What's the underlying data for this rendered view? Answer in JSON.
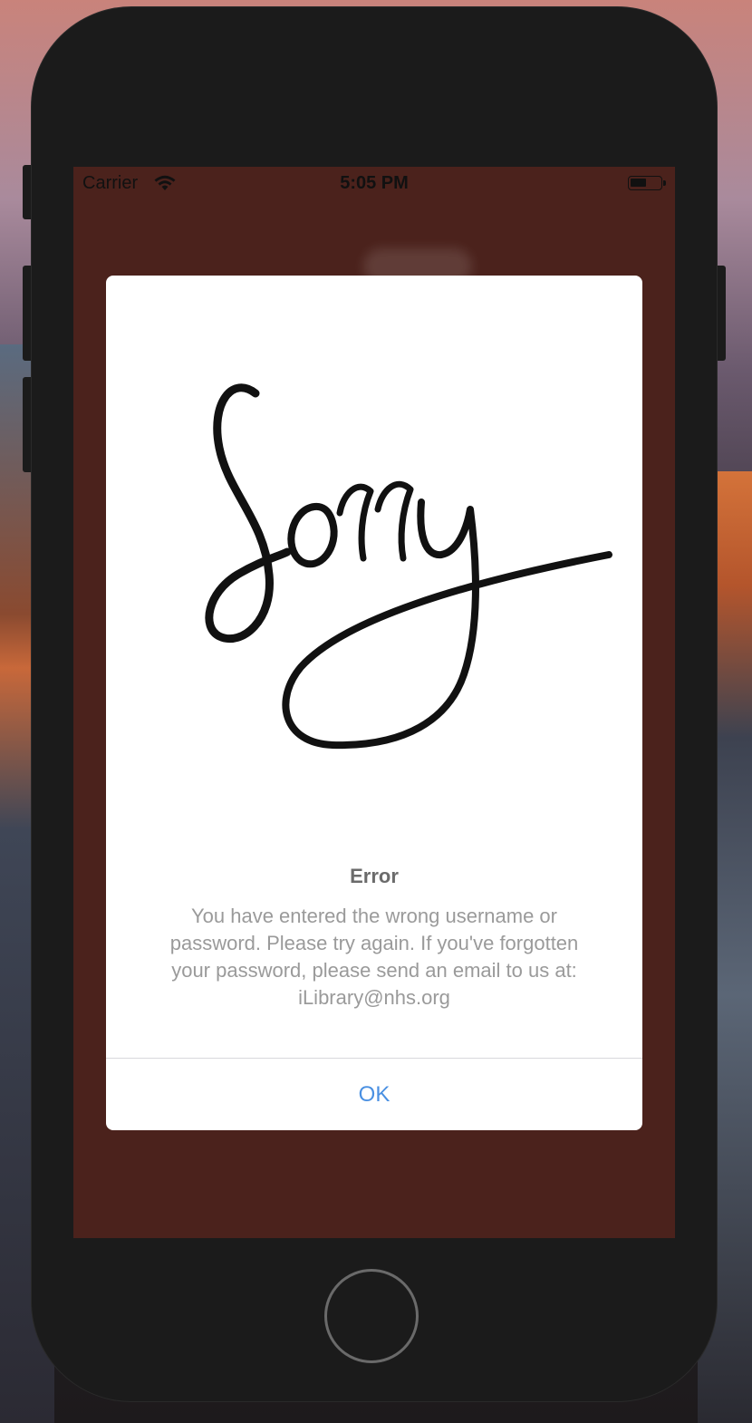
{
  "status_bar": {
    "carrier": "Carrier",
    "time": "5:05 PM",
    "wifi_icon": "wifi-icon",
    "battery_icon": "battery-icon"
  },
  "alert": {
    "image_icon": "sorry-lettering",
    "image_text": "Sorry",
    "title": "Error",
    "message": "You have entered the wrong username or password. Please try again. If you've forgotten your password, please send an email to us at: iLibrary@nhs.org",
    "ok_label": "OK"
  },
  "colors": {
    "screen_background": "#4b221c",
    "alert_background": "#ffffff",
    "button_accent": "#4a90e2",
    "title_color": "#6b6b6b",
    "message_color": "#9a9a9a"
  }
}
